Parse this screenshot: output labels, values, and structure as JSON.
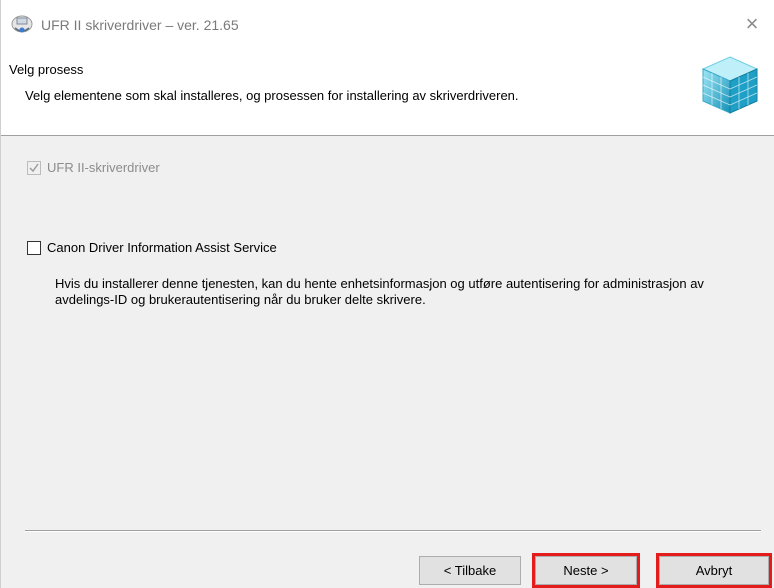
{
  "window": {
    "title": "UFR II skriverdriver – ver. 21.65",
    "close_glyph": "×"
  },
  "header": {
    "title": "Velg prosess",
    "description": "Velg elementene som skal installeres, og prosessen for installering av skriverdriveren."
  },
  "options": [
    {
      "label": "UFR II-skriverdriver",
      "checked": true,
      "disabled": true
    },
    {
      "label": "Canon Driver Information Assist Service",
      "checked": false,
      "disabled": false,
      "description": "Hvis du installerer denne tjenesten, kan du hente enhetsinformasjon og utføre autentisering for administrasjon av avdelings-ID og brukerautentisering når du bruker delte skrivere."
    }
  ],
  "buttons": {
    "back": "< Tilbake",
    "next": "Neste >",
    "cancel": "Avbryt"
  },
  "colors": {
    "highlight": "#e31b1b",
    "logo_cyan": "#27b6d6"
  },
  "icons": {
    "title": "printer-setup-icon",
    "logo": "canon-cube-logo-icon",
    "close": "close-icon"
  }
}
